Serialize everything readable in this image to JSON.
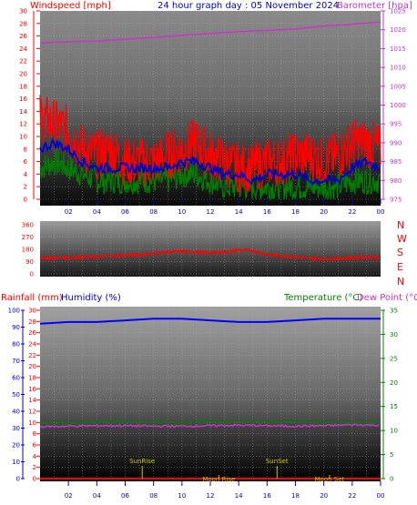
{
  "header": {
    "windspeed": "Windspeed [mph]",
    "title": "24 hour graph day : 05 November 2024",
    "barometer": "Barometer [hpa]",
    "rainfall": "Rainfall (mm)",
    "humidity": "Humidity (%)",
    "temperature": "Temperature (°C)",
    "dewpoint": "Dew Point (°C"
  },
  "colors": {
    "wind": "#ff0000",
    "avgwind": "#0000cc",
    "gust": "#008000",
    "barometer": "#cc33cc",
    "direction": "#ff0000",
    "humidity": "#0000ff",
    "temperature": "#008000",
    "dewpoint": "#cc33cc",
    "rain": "#ff0000",
    "events": "#c8c800"
  },
  "chart_data": [
    {
      "type": "line",
      "title": "24 hour graph day : 05 November 2024",
      "xlabel": "",
      "x_ticks": [
        "02",
        "04",
        "06",
        "08",
        "10",
        "12",
        "14",
        "16",
        "18",
        "20",
        "22",
        "00"
      ],
      "left_axis": {
        "label": "Windspeed [mph]",
        "range": [
          0,
          30
        ],
        "ticks": [
          "0",
          "2",
          "4",
          "6",
          "8",
          "10",
          "12",
          "14",
          "16",
          "18",
          "20",
          "22",
          "24",
          "26",
          "28",
          "30"
        ]
      },
      "right_axis": {
        "label": "Barometer [hpa]",
        "range": [
          975,
          1025
        ],
        "ticks": [
          "975",
          "980",
          "985",
          "990",
          "995",
          "1000",
          "1005",
          "1010",
          "1015",
          "1020",
          "1025"
        ]
      },
      "series": [
        {
          "name": "Windspeed",
          "axis": "left",
          "hours": [
            0,
            1,
            2,
            3,
            4,
            5,
            6,
            7,
            8,
            9,
            10,
            11,
            12,
            13,
            14,
            15,
            16,
            17,
            18,
            19,
            20,
            21,
            22,
            23,
            24
          ],
          "values": [
            13,
            12,
            11,
            8,
            7,
            8,
            6,
            6,
            6,
            7,
            8,
            9,
            7,
            6,
            5,
            5,
            6,
            6,
            7,
            7,
            6,
            7,
            9,
            9,
            8
          ]
        },
        {
          "name": "Average wind",
          "axis": "left",
          "hours": [
            0,
            1,
            2,
            3,
            4,
            5,
            6,
            7,
            8,
            9,
            10,
            11,
            12,
            13,
            14,
            15,
            16,
            17,
            18,
            19,
            20,
            21,
            22,
            23,
            24
          ],
          "values": [
            8,
            9,
            8,
            6,
            5,
            5,
            5,
            5,
            5,
            5,
            6,
            6,
            5,
            4,
            4,
            3,
            4,
            4,
            4,
            3,
            3,
            3,
            5,
            6,
            5
          ]
        },
        {
          "name": "Gust",
          "axis": "left",
          "hours": [
            0,
            1,
            2,
            3,
            4,
            5,
            6,
            7,
            8,
            9,
            10,
            11,
            12,
            13,
            14,
            15,
            16,
            17,
            18,
            19,
            20,
            21,
            22,
            23,
            24
          ],
          "values": [
            5,
            6,
            5,
            4,
            3,
            3,
            3,
            3,
            3,
            3,
            4,
            4,
            3,
            2,
            2,
            2,
            2,
            2,
            2,
            2,
            2,
            2,
            3,
            3,
            3
          ]
        },
        {
          "name": "Barometer",
          "axis": "right",
          "hours": [
            0,
            2,
            4,
            6,
            8,
            10,
            12,
            14,
            16,
            18,
            20,
            22,
            24
          ],
          "values": [
            1016.5,
            1016.8,
            1017,
            1017.5,
            1018,
            1018.5,
            1019,
            1019.5,
            1019.8,
            1020.2,
            1021,
            1021.5,
            1022
          ]
        }
      ]
    },
    {
      "type": "line",
      "title": "",
      "y_range": [
        0,
        360
      ],
      "y_ticks": [
        "0",
        "90",
        "180",
        "270",
        "360"
      ],
      "direction_labels": [
        "N",
        "W",
        "S",
        "E",
        "N"
      ],
      "series": [
        {
          "name": "Wind direction",
          "hours": [
            0,
            1,
            2,
            3,
            4,
            5,
            6,
            7,
            8,
            9,
            10,
            11,
            12,
            13,
            14,
            15,
            16,
            17,
            18,
            19,
            20,
            21,
            22,
            23,
            24
          ],
          "values": [
            115,
            118,
            120,
            122,
            125,
            130,
            135,
            140,
            150,
            160,
            165,
            160,
            155,
            160,
            175,
            170,
            145,
            130,
            125,
            115,
            110,
            112,
            118,
            122,
            120
          ]
        }
      ]
    },
    {
      "type": "line",
      "title": "",
      "x_ticks": [
        "02",
        "04",
        "06",
        "08",
        "10",
        "12",
        "14",
        "16",
        "18",
        "20",
        "22",
        "00"
      ],
      "left_axis": {
        "label": "Rainfall (mm)",
        "range": [
          0,
          30
        ],
        "ticks": [
          "0",
          "2",
          "4",
          "6",
          "8",
          "10",
          "12",
          "14",
          "16",
          "18",
          "20",
          "22",
          "24",
          "26",
          "28",
          "30"
        ]
      },
      "humidity_axis": {
        "label": "Humidity (%)",
        "range": [
          0,
          100
        ],
        "ticks": [
          "0",
          "10",
          "20",
          "30",
          "40",
          "50",
          "60",
          "70",
          "80",
          "90",
          "100"
        ]
      },
      "right_axis": {
        "label": "Temperature (°C)",
        "range": [
          0,
          35
        ],
        "ticks": [
          "0",
          "5",
          "10",
          "15",
          "20",
          "25",
          "30",
          "35"
        ]
      },
      "series": [
        {
          "name": "Humidity",
          "axis": "humidity",
          "hours": [
            0,
            2,
            4,
            6,
            8,
            10,
            12,
            14,
            16,
            18,
            20,
            22,
            24
          ],
          "values": [
            92,
            93,
            93,
            94,
            95,
            95,
            94,
            93,
            93,
            94,
            95,
            95,
            95
          ]
        },
        {
          "name": "Temperature",
          "axis": "right",
          "hours": [
            0,
            2,
            4,
            6,
            8,
            10,
            12,
            14,
            16,
            18,
            20,
            22,
            24
          ],
          "values": [
            11.5,
            11.6,
            11.8,
            11.8,
            11.7,
            11.7,
            11.9,
            11.9,
            11.8,
            11.8,
            11.7,
            11.6,
            11.8
          ]
        },
        {
          "name": "Dew Point",
          "axis": "right",
          "hours": [
            0,
            2,
            4,
            6,
            8,
            10,
            12,
            14,
            16,
            18,
            20,
            22,
            24
          ],
          "values": [
            10.8,
            10.9,
            11,
            11,
            10.9,
            10.9,
            11,
            11.1,
            11,
            10.9,
            11,
            11.2,
            11.1
          ]
        },
        {
          "name": "Rainfall",
          "axis": "left",
          "hours": [
            0,
            24
          ],
          "values": [
            0,
            0
          ]
        }
      ],
      "events": [
        {
          "label": "SunRise",
          "hour": 7.2
        },
        {
          "label": "Moon Rise",
          "hour": 12.6
        },
        {
          "label": "SunSet",
          "hour": 16.7
        },
        {
          "label": "Moon Set",
          "hour": 20.4
        }
      ]
    }
  ]
}
